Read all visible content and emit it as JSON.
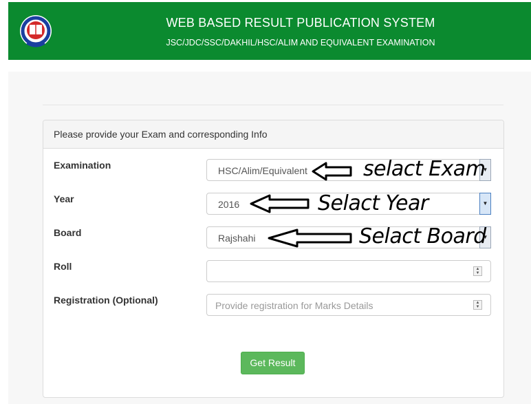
{
  "header": {
    "title": "WEB BASED RESULT PUBLICATION SYSTEM",
    "subtitle": "JSC/JDC/SSC/DAKHIL/HSC/ALIM AND EQUIVALENT EXAMINATION"
  },
  "panel": {
    "heading": "Please provide your Exam and corresponding Info"
  },
  "form": {
    "examination": {
      "label": "Examination",
      "value": "HSC/Alim/Equivalent"
    },
    "year": {
      "label": "Year",
      "value": "2016"
    },
    "board": {
      "label": "Board",
      "value": "Rajshahi"
    },
    "roll": {
      "label": "Roll",
      "value": ""
    },
    "registration": {
      "label": "Registration (Optional)",
      "placeholder": "Provide registration for Marks Details"
    }
  },
  "submit": {
    "label": "Get Result"
  },
  "annotations": {
    "exam": "selact Exam",
    "year": "Selact Year",
    "board": "Selact Board"
  },
  "colors": {
    "header_bg": "#0b8a2f",
    "button_bg": "#5cb85c"
  },
  "icons": {
    "logo": "education-board-seal-icon",
    "dropdown": "chevron-down-icon",
    "spinner": "up-down-spinner-icon",
    "annotation": "left-arrow-icon"
  }
}
